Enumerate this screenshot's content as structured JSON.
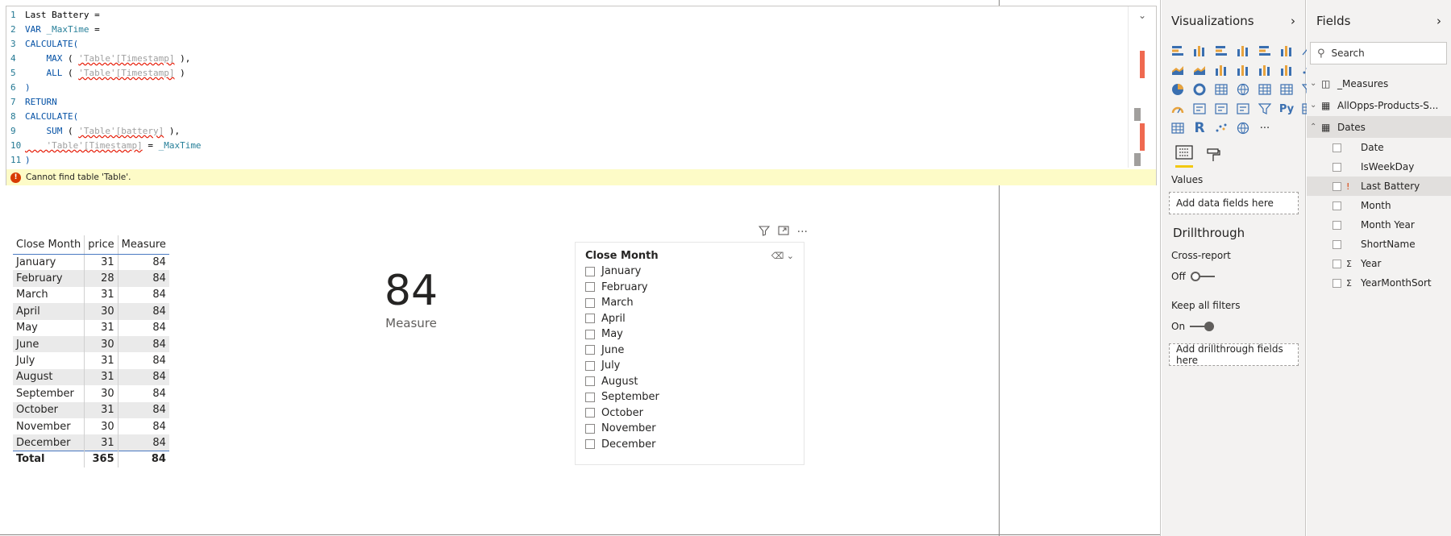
{
  "editor": {
    "lines": [
      {
        "n": "1",
        "parts": [
          {
            "t": "Last Battery =",
            "c": "ct"
          }
        ]
      },
      {
        "n": "2",
        "parts": [
          {
            "t": "VAR ",
            "c": "kw"
          },
          {
            "t": "_MaxTime",
            "c": "vr"
          },
          {
            "t": " =",
            "c": "ct"
          }
        ]
      },
      {
        "n": "3",
        "parts": [
          {
            "t": "CALCULATE(",
            "c": "kw"
          }
        ]
      },
      {
        "n": "4",
        "parts": [
          {
            "t": "    MAX ",
            "c": "kw"
          },
          {
            "t": "( ",
            "c": "ct"
          },
          {
            "t": "'Table'[Timestamp]",
            "c": "tb"
          },
          {
            "t": " ),",
            "c": "ct"
          }
        ]
      },
      {
        "n": "5",
        "parts": [
          {
            "t": "    ALL ",
            "c": "kw"
          },
          {
            "t": "( ",
            "c": "ct"
          },
          {
            "t": "'Table'[Timestamp]",
            "c": "tb"
          },
          {
            "t": " )",
            "c": "ct"
          }
        ]
      },
      {
        "n": "6",
        "parts": [
          {
            "t": ")",
            "c": "kw"
          }
        ]
      },
      {
        "n": "7",
        "parts": [
          {
            "t": "RETURN",
            "c": "kw"
          }
        ]
      },
      {
        "n": "8",
        "parts": [
          {
            "t": "CALCULATE(",
            "c": "kw"
          }
        ]
      },
      {
        "n": "9",
        "parts": [
          {
            "t": "    SUM ",
            "c": "kw"
          },
          {
            "t": "( ",
            "c": "ct"
          },
          {
            "t": "'Table'[battery]",
            "c": "tb"
          },
          {
            "t": " ),",
            "c": "ct"
          }
        ]
      },
      {
        "n": "10",
        "parts": [
          {
            "t": "    'Table'[Timestamp]",
            "c": "tb"
          },
          {
            "t": " = ",
            "c": "ct"
          },
          {
            "t": "_MaxTime",
            "c": "vr"
          }
        ]
      },
      {
        "n": "11",
        "parts": [
          {
            "t": ")",
            "c": "kw"
          }
        ]
      }
    ],
    "error": "Cannot find table 'Table'."
  },
  "table": {
    "headers": [
      "Close Month",
      "price",
      "Measure"
    ],
    "rows": [
      [
        "January",
        "31",
        "84"
      ],
      [
        "February",
        "28",
        "84"
      ],
      [
        "March",
        "31",
        "84"
      ],
      [
        "April",
        "30",
        "84"
      ],
      [
        "May",
        "31",
        "84"
      ],
      [
        "June",
        "30",
        "84"
      ],
      [
        "July",
        "31",
        "84"
      ],
      [
        "August",
        "31",
        "84"
      ],
      [
        "September",
        "30",
        "84"
      ],
      [
        "October",
        "31",
        "84"
      ],
      [
        "November",
        "30",
        "84"
      ],
      [
        "December",
        "31",
        "84"
      ]
    ],
    "total": [
      "Total",
      "365",
      "84"
    ]
  },
  "card": {
    "value": "84",
    "label": "Measure"
  },
  "slicer": {
    "title": "Close Month",
    "items": [
      "January",
      "February",
      "March",
      "April",
      "May",
      "June",
      "July",
      "August",
      "September",
      "October",
      "November",
      "December"
    ]
  },
  "visualizations": {
    "title": "Visualizations",
    "values_label": "Values",
    "values_placeholder": "Add data fields here",
    "drillthrough_title": "Drillthrough",
    "cross_report_label": "Cross-report",
    "cross_report_state": "Off",
    "keep_filters_label": "Keep all filters",
    "keep_filters_state": "On",
    "drill_placeholder": "Add drillthrough fields here",
    "more_glyph": "···",
    "py_glyph": "Py",
    "r_glyph": "R"
  },
  "fields": {
    "title": "Fields",
    "search_placeholder": "Search",
    "tables": [
      {
        "name": "_Measures"
      },
      {
        "name": "AllOpps-Products-S..."
      },
      {
        "name": "Dates"
      }
    ],
    "dates_fields": [
      {
        "name": "Date",
        "sigma": false,
        "warn": false
      },
      {
        "name": "IsWeekDay",
        "sigma": false,
        "warn": false
      },
      {
        "name": "Last Battery",
        "sigma": false,
        "warn": true
      },
      {
        "name": "Month",
        "sigma": false,
        "warn": false
      },
      {
        "name": "Month Year",
        "sigma": false,
        "warn": false
      },
      {
        "name": "ShortName",
        "sigma": false,
        "warn": false
      },
      {
        "name": "Year",
        "sigma": true,
        "warn": false
      },
      {
        "name": "YearMonthSort",
        "sigma": true,
        "warn": false
      }
    ]
  },
  "colors": {
    "accent": "#f2c811",
    "error": "#d83b01",
    "table_border": "#4a7ac2"
  }
}
